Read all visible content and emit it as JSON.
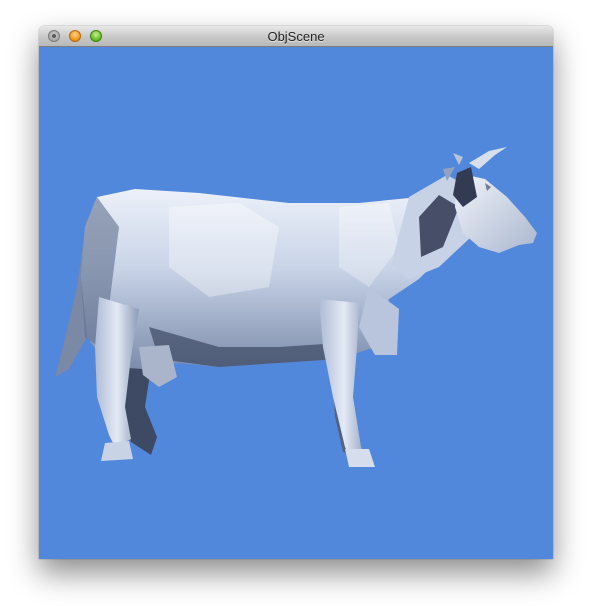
{
  "window": {
    "title": "ObjScene"
  },
  "scene": {
    "background_color": "#5188dc",
    "model_color": "#dfe7f5",
    "shadow_color": "#4a5a7a"
  },
  "icons": {
    "close": "close-icon",
    "minimize": "minimize-icon",
    "zoom": "zoom-icon"
  }
}
